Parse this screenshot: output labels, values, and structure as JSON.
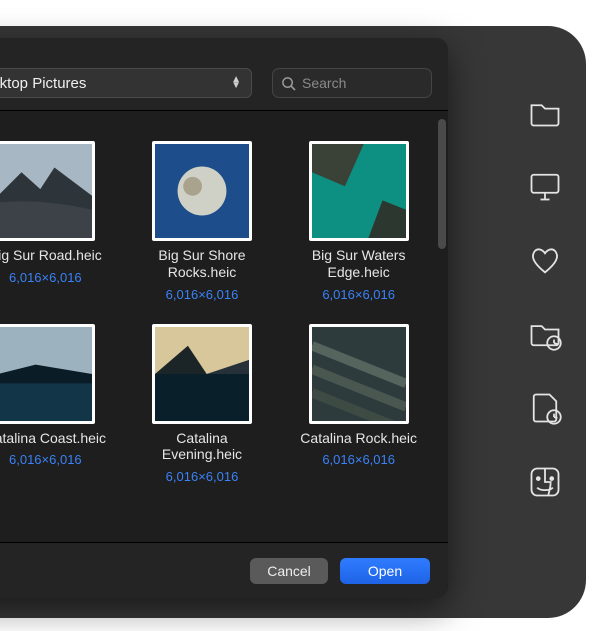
{
  "toolbar": {
    "path_label": "Desktop Pictures",
    "search_placeholder": "Search"
  },
  "files": [
    {
      "name": "Big Sur Road.heic",
      "dims": "6,016×6,016"
    },
    {
      "name": "Big Sur Shore Rocks.heic",
      "dims": "6,016×6,016"
    },
    {
      "name": "Big Sur Waters Edge.heic",
      "dims": "6,016×6,016"
    },
    {
      "name": "Catalina Coast.heic",
      "dims": "6,016×6,016"
    },
    {
      "name": "Catalina Evening.heic",
      "dims": "6,016×6,016"
    },
    {
      "name": "Catalina Rock.heic",
      "dims": "6,016×6,016"
    }
  ],
  "footer": {
    "cancel_label": "Cancel",
    "open_label": "Open"
  },
  "sidebar_icons": [
    "folder-icon",
    "desktop-icon",
    "heart-icon",
    "recent-folder-icon",
    "recent-document-icon",
    "finder-face-icon"
  ]
}
